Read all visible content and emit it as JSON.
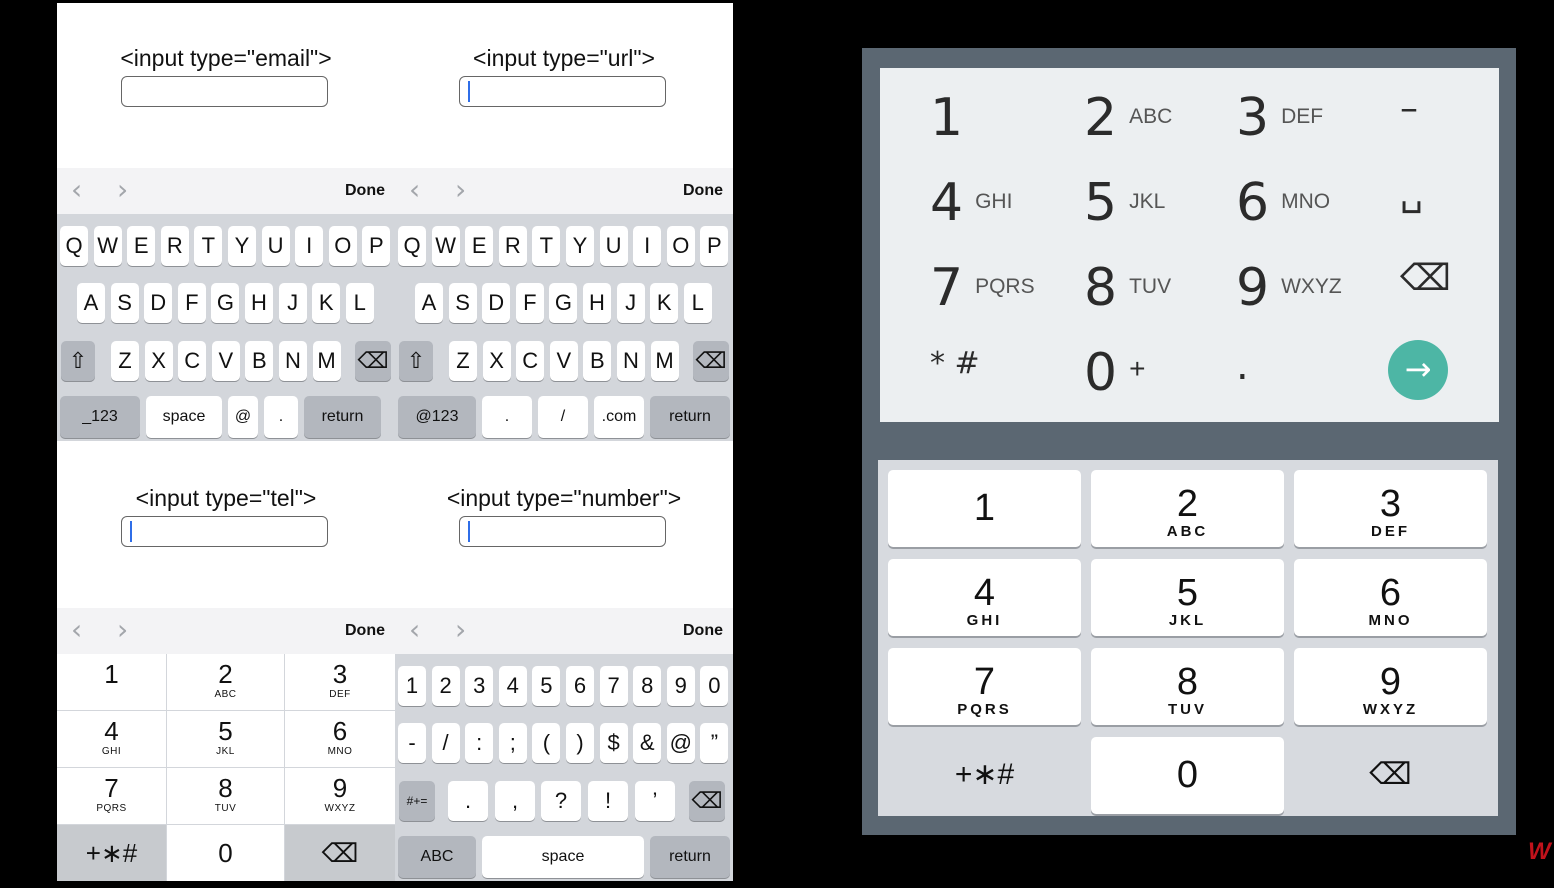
{
  "ios": {
    "email_label": "<input type=\"email\">",
    "url_label": "<input type=\"url\">",
    "tel_label": "<input type=\"tel\">",
    "number_label": "<input type=\"number\">",
    "done": "Done",
    "prev": "‹",
    "next": "›",
    "row1": [
      "Q",
      "W",
      "E",
      "R",
      "T",
      "Y",
      "U",
      "I",
      "O",
      "P"
    ],
    "row2": [
      "A",
      "S",
      "D",
      "F",
      "G",
      "H",
      "J",
      "K",
      "L"
    ],
    "row3": [
      "Z",
      "X",
      "C",
      "V",
      "B",
      "N",
      "M"
    ],
    "shift": "⇧",
    "backspace": "⌫",
    "email_bottom": [
      "_123",
      "space",
      "@",
      ".",
      "return"
    ],
    "url_bottom": [
      "@123",
      ".",
      "/",
      ".com",
      "return"
    ],
    "tel_keys": [
      {
        "d": "1",
        "s": ""
      },
      {
        "d": "2",
        "s": "ABC"
      },
      {
        "d": "3",
        "s": "DEF"
      },
      {
        "d": "4",
        "s": "GHI"
      },
      {
        "d": "5",
        "s": "JKL"
      },
      {
        "d": "6",
        "s": "MNO"
      },
      {
        "d": "7",
        "s": "PQRS"
      },
      {
        "d": "8",
        "s": "TUV"
      },
      {
        "d": "9",
        "s": "WXYZ"
      },
      {
        "d": "+∗#",
        "s": ""
      },
      {
        "d": "0",
        "s": ""
      },
      {
        "d": "⌫",
        "s": ""
      }
    ],
    "num_row1": [
      "1",
      "2",
      "3",
      "4",
      "5",
      "6",
      "7",
      "8",
      "9",
      "0"
    ],
    "num_row2": [
      "-",
      "/",
      ":",
      ";",
      "(",
      ")",
      "$",
      "&",
      "@",
      "”"
    ],
    "num_row3": [
      "#+=",
      ".",
      ",",
      "?",
      "!",
      "’",
      "⌫"
    ],
    "num_bottom": [
      "ABC",
      "space",
      "return"
    ]
  },
  "android": {
    "top_keys": [
      {
        "n": "1",
        "t": ""
      },
      {
        "n": "2",
        "t": "ABC"
      },
      {
        "n": "3",
        "t": "DEF"
      },
      {
        "n": "–",
        "t": ""
      },
      {
        "n": "4",
        "t": "GHI"
      },
      {
        "n": "5",
        "t": "JKL"
      },
      {
        "n": "6",
        "t": "MNO"
      },
      {
        "n": "␣",
        "t": ""
      },
      {
        "n": "7",
        "t": "PQRS"
      },
      {
        "n": "8",
        "t": "TUV"
      },
      {
        "n": "9",
        "t": "WXYZ"
      },
      {
        "n": "⌫",
        "t": ""
      },
      {
        "n": "* #",
        "t": ""
      },
      {
        "n": "0",
        "t": "+"
      },
      {
        "n": ".",
        "t": ""
      }
    ],
    "go_icon": "→",
    "grid_keys": [
      {
        "n": "1",
        "s": ""
      },
      {
        "n": "2",
        "s": "ABC"
      },
      {
        "n": "3",
        "s": "DEF"
      },
      {
        "n": "4",
        "s": "GHI"
      },
      {
        "n": "5",
        "s": "JKL"
      },
      {
        "n": "6",
        "s": "MNO"
      },
      {
        "n": "7",
        "s": "PQRS"
      },
      {
        "n": "8",
        "s": "TUV"
      },
      {
        "n": "9",
        "s": "WXYZ"
      },
      {
        "n": "+∗#",
        "s": ""
      },
      {
        "n": "0",
        "s": ""
      },
      {
        "n": "⌫",
        "s": ""
      }
    ]
  },
  "colors": {
    "cursor": "#2f6ee8",
    "go_button": "#4db6a5",
    "android_bg": "#5b6772"
  }
}
